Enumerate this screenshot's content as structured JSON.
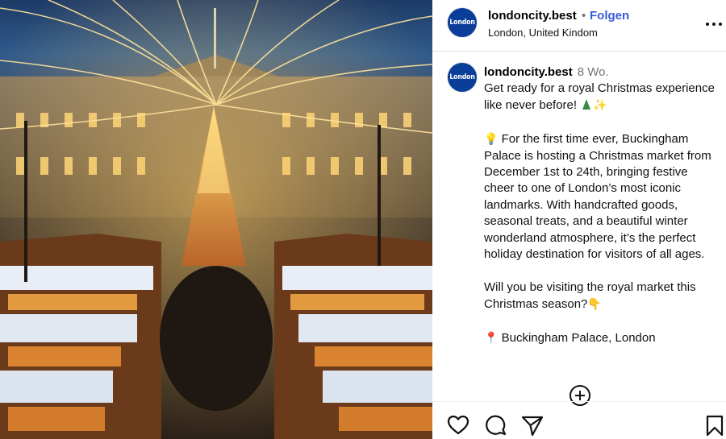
{
  "post": {
    "username": "londoncity.best",
    "separator": "•",
    "follow_label": "Folgen",
    "location": "London, United Kindom",
    "avatar_text": "London",
    "more_icon": "more-options-icon"
  },
  "comment": {
    "username": "londoncity.best",
    "time": "8 Wo.",
    "caption_line1": "Get ready for a royal Christmas experience like never before!",
    "caption_para2": "For the first time ever, Buckingham Palace is hosting a Christmas market from December 1st to 24th, bringing festive cheer to one of London’s most iconic landmarks. With handcrafted goods, seasonal treats, and a beautiful winter wonderland atmosphere, it’s the perfect holiday destination for visitors of all ages.",
    "caption_para3": "Will you be visiting the royal market this Christmas season?",
    "caption_para4": "Buckingham Palace, London",
    "emoji": {
      "tree": "christmas-tree-emoji",
      "sparkles": "✨",
      "bulb": "💡",
      "hand": "👇",
      "pin": "📍"
    }
  },
  "actions": {
    "like": "heart-icon",
    "comment": "comment-icon",
    "share": "share-icon",
    "save": "bookmark-icon",
    "load_more": "plus-circle-icon"
  },
  "colors": {
    "follow": "#3a5bd9",
    "avatar_bg": "#0b3e99",
    "muted": "#737373"
  }
}
